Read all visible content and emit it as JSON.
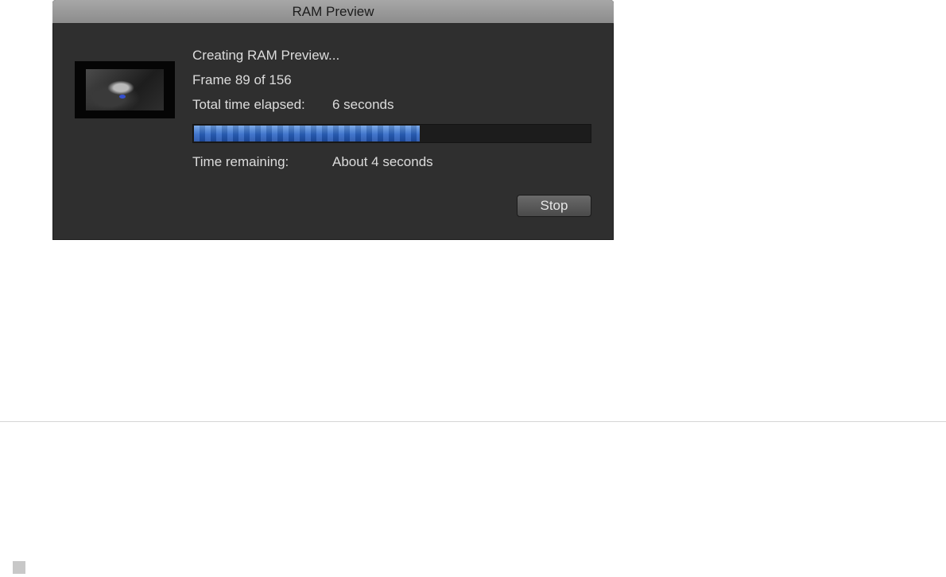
{
  "dialog": {
    "title": "RAM Preview",
    "status_line": "Creating RAM Preview...",
    "frame_line": "Frame 89 of 156",
    "elapsed_label": "Total time elapsed:",
    "elapsed_value": "6 seconds",
    "remaining_label": "Time remaining:",
    "remaining_value": "About 4 seconds",
    "progress_fraction": 0.57,
    "stop_label": "Stop",
    "progress_color": "#2c66c6"
  }
}
